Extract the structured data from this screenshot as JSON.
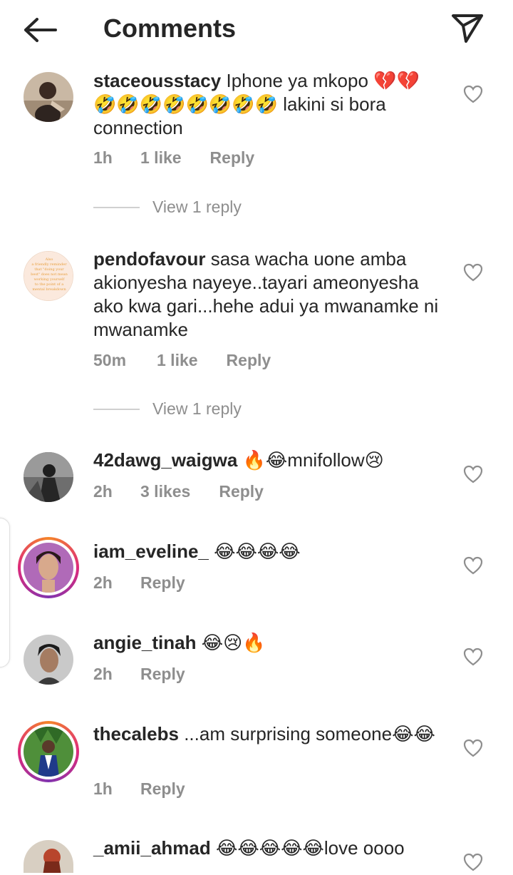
{
  "header": {
    "title": "Comments"
  },
  "comments": [
    {
      "username": "staceousstacy",
      "text": "Iphone ya mkopo 💔💔🤣🤣🤣🤣🤣🤣🤣🤣 lakini si bora connection",
      "time": "1h",
      "likes": "1 like",
      "reply_label": "Reply",
      "view_replies": "View 1 reply",
      "avatar_icon": "woman-photo"
    },
    {
      "username": "pendofavour",
      "text": "sasa wacha uone amba akionyesha nayeye..tayari ameonyesha ako kwa gari...hehe adui ya mwanamke ni mwanamke",
      "time": "50m",
      "likes": "1 like",
      "reply_label": "Reply",
      "view_replies": "View 1 reply",
      "avatar_text": "Also a friendly reminder that \"doing your best\" does not mean working yourself to the point of a mental breakdown",
      "avatar_icon": "quote-card"
    },
    {
      "username": "42dawg_waigwa",
      "text": "🔥😂mnifollow😢",
      "time": "2h",
      "likes": "3 likes",
      "reply_label": "Reply",
      "avatar_icon": "man-photo-bw"
    },
    {
      "username": "iam_eveline_",
      "text": "😂😂😂😂",
      "time": "2h",
      "reply_label": "Reply",
      "avatar_icon": "woman-photo"
    },
    {
      "username": "angie_tinah",
      "text": "😂😢🔥",
      "time": "2h",
      "reply_label": "Reply",
      "avatar_icon": "woman-photo"
    },
    {
      "username": "thecalebs",
      "text": "...am surprising someone😂😂",
      "time": "1h",
      "reply_label": "Reply",
      "avatar_icon": "man-photo"
    },
    {
      "username": "_amii_ahmad",
      "text": "😂😂😂😂😂love oooo",
      "avatar_icon": "illustration"
    }
  ]
}
